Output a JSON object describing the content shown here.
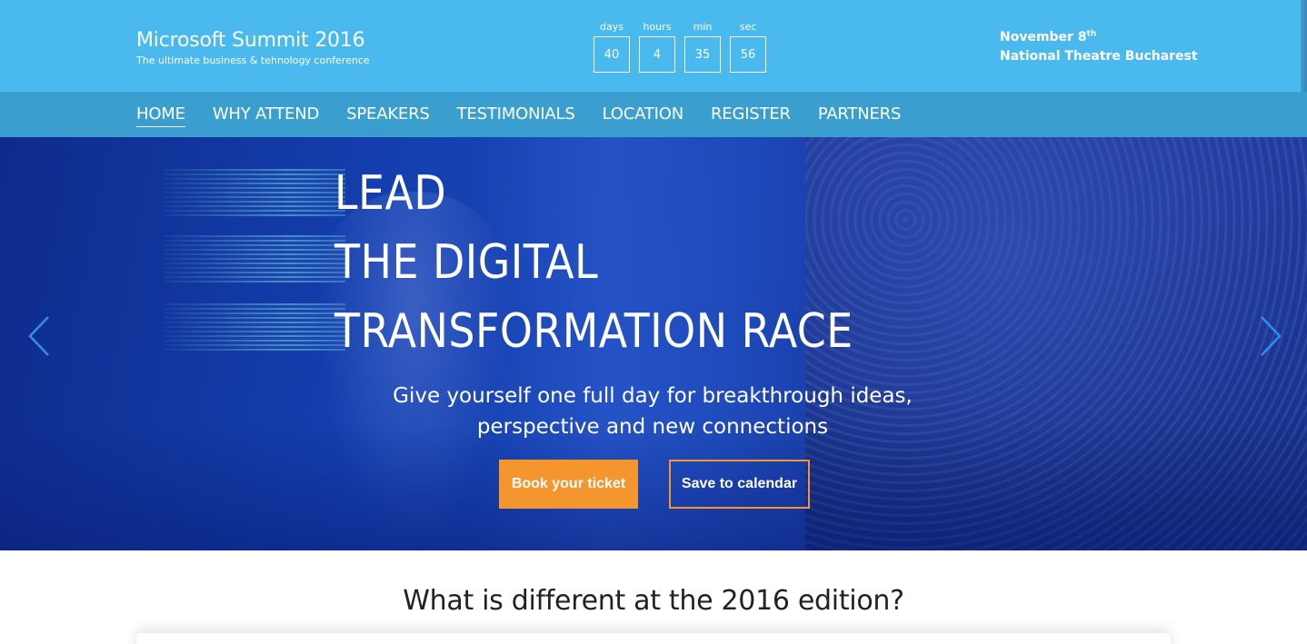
{
  "header": {
    "title": "Microsoft Summit 2016",
    "subtitle": "The ultimate business & tehnology conference",
    "countdown": [
      {
        "label": "days",
        "value": "40"
      },
      {
        "label": "hours",
        "value": "4"
      },
      {
        "label": "min",
        "value": "35"
      },
      {
        "label": "sec",
        "value": "56"
      }
    ],
    "date_text": "November 8",
    "date_suffix": "th",
    "venue": "National Theatre Bucharest"
  },
  "nav": {
    "items": [
      "HOME",
      "WHY ATTEND",
      "SPEAKERS",
      "TESTIMONIALS",
      "LOCATION",
      "REGISTER",
      "PARTNERS"
    ],
    "active": "HOME"
  },
  "hero": {
    "headline": [
      "LEAD",
      "THE DIGITAL",
      "TRANSFORMATION RACE"
    ],
    "tagline": [
      "Give yourself one full day for breakthrough ideas,",
      "perspective and new connections"
    ],
    "primary_button": "Book your ticket",
    "secondary_button": "Save to calendar",
    "prev_icon": "chevron-left-icon",
    "next_icon": "chevron-right-icon"
  },
  "section": {
    "title": "What is different at the 2016 edition?"
  },
  "colors": {
    "header_bg": "#4ab9ed",
    "nav_bg": "#3a9fce",
    "accent_orange": "#f5952e",
    "arrow_blue": "#2e8ff0"
  }
}
